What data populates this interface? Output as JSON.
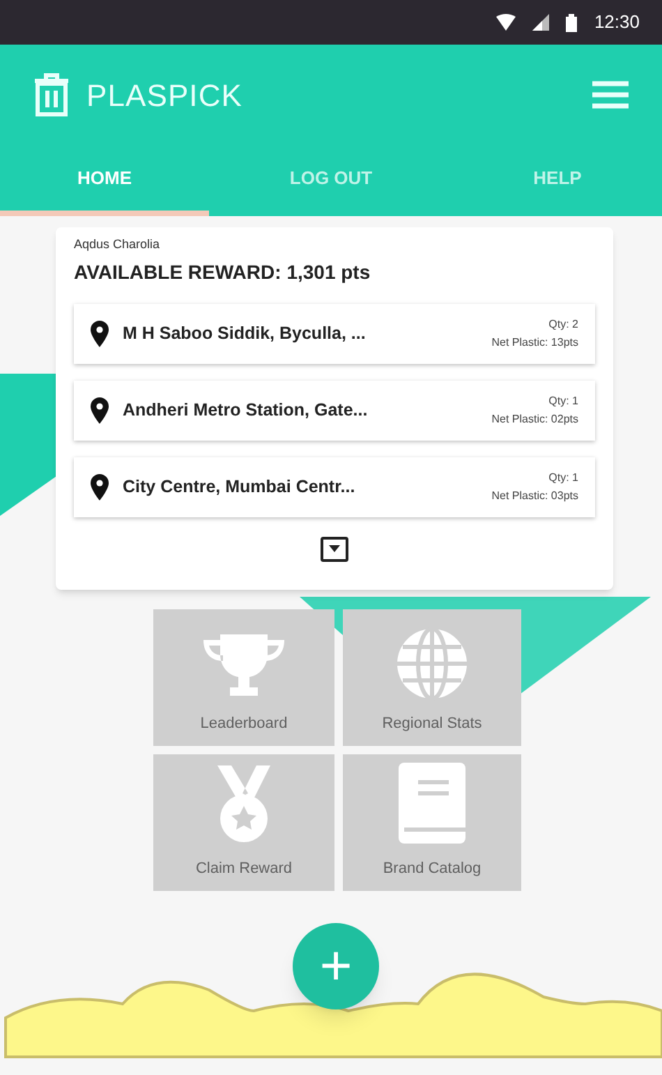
{
  "status_bar": {
    "time": "12:30"
  },
  "app_bar": {
    "title": "PLASPICK"
  },
  "tabs": [
    {
      "label": "HOME",
      "selected": true
    },
    {
      "label": "LOG OUT",
      "selected": false
    },
    {
      "label": "HELP",
      "selected": false
    }
  ],
  "reward_card": {
    "user_name": "Aqdus Charolia",
    "reward": "AVAILABLE REWARD:  1,301 pts",
    "entries": [
      {
        "location": "M H Saboo Siddik, Byculla, ...",
        "qty": "Qty: 2",
        "net_plastic": "Net Plastic: 13pts"
      },
      {
        "location": "Andheri Metro Station, Gate...",
        "qty": "Qty: 1",
        "net_plastic": "Net Plastic: 02pts"
      },
      {
        "location": "City Centre, Mumbai Centr...",
        "qty": "Qty: 1",
        "net_plastic": "Net Plastic: 03pts"
      }
    ]
  },
  "tiles": [
    {
      "kind": "trophy",
      "label": "Leaderboard"
    },
    {
      "kind": "globe",
      "label": "Regional Stats"
    },
    {
      "kind": "medal",
      "label": "Claim Reward"
    },
    {
      "kind": "book",
      "label": "Brand Catalog"
    }
  ],
  "fab": {
    "symbol": "+"
  }
}
